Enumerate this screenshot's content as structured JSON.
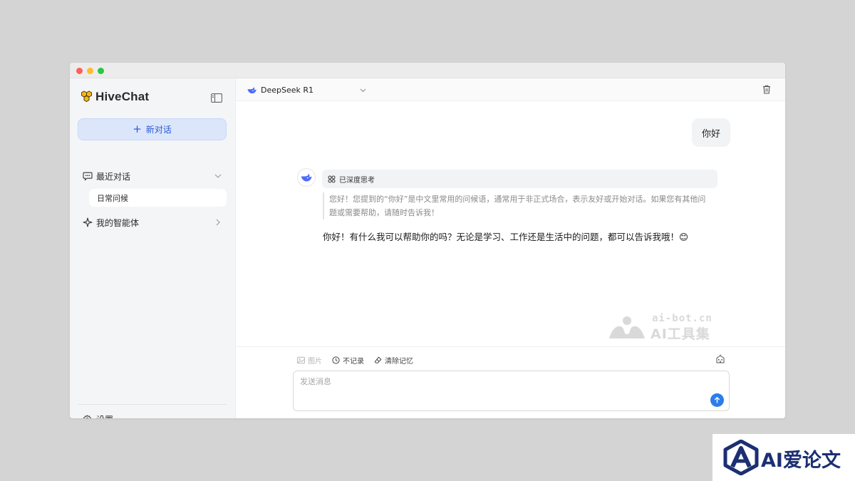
{
  "app": {
    "name": "HiveChat"
  },
  "sidebar": {
    "new_chat_label": "新对话",
    "recent_label": "最近对话",
    "recent_items": [
      {
        "label": "日常问候"
      }
    ],
    "agents_label": "我的智能体",
    "settings_label": "设置"
  },
  "topbar": {
    "model_name": "DeepSeek R1"
  },
  "conversation": {
    "user_message": "你好",
    "thinking_label": "已深度思考",
    "thinking_content": "您好！您提到的“你好”是中文里常用的问候语，通常用于非正式场合，表示友好或开始对话。如果您有其他问题或需要帮助，请随时告诉我！",
    "answer": "你好！有什么我可以帮助你的吗？无论是学习、工作还是生活中的问题，都可以告诉我哦！😊"
  },
  "input_area": {
    "tools": {
      "image": "图片",
      "no_record": "不记录",
      "clear_memory": "清除记忆"
    },
    "placeholder": "发送消息"
  },
  "watermark": {
    "line1": "ai-bot.cn",
    "line2": "AI工具集"
  },
  "corner_badge": {
    "text": "AI爱论文"
  },
  "colors": {
    "accent": "#2b7de9",
    "new_chat_bg": "#dbe6fb",
    "new_chat_text": "#2c5ad6",
    "sidebar_bg": "#f4f5f7",
    "brand_yellow": "#f6b81a",
    "badge_navy": "#1c2f73"
  }
}
